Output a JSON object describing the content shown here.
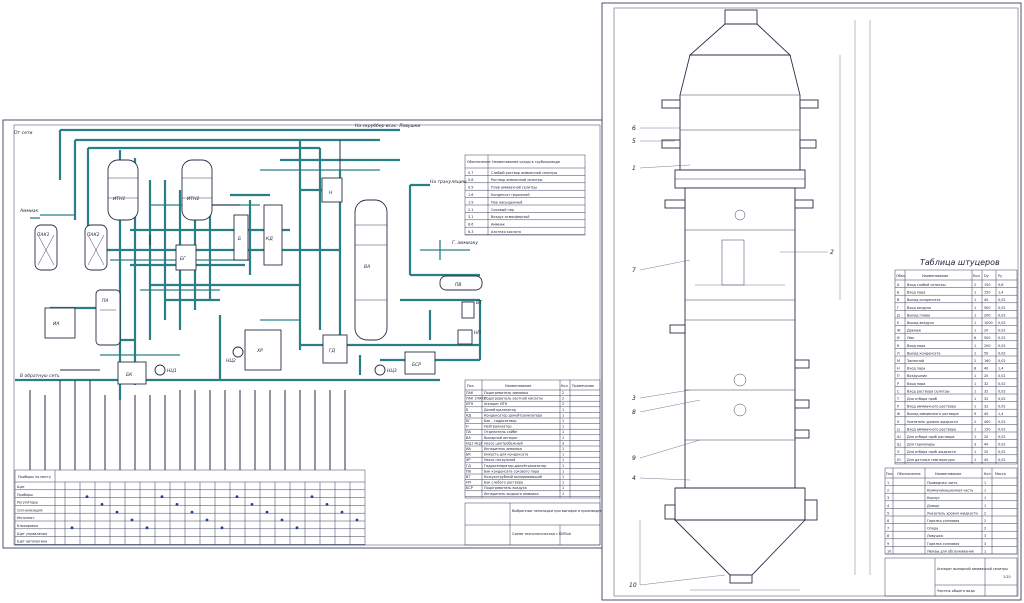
{
  "scheme": {
    "equipment": [
      "ПАК1",
      "ПАК2",
      "ИТН1",
      "ИТН2",
      "ПА",
      "ИА",
      "БК",
      "НЦ1",
      "НЦ2",
      "НЦ3",
      "БГ",
      "Б",
      "КД",
      "Н",
      "ВА",
      "ХР",
      "ГД",
      "ПВ",
      "ВТ",
      "НП",
      "БСР"
    ],
    "flow_labels": [
      "На скруббер всас. Ловушки",
      "На грануляцию",
      "Г. аммиаку",
      "Аммиак",
      "В обратную сеть",
      "От сети"
    ],
    "flows_table": {
      "header": [
        "Обозначение",
        "Наименование среды в трубопроводе"
      ],
      "rows": [
        [
          "0.7",
          "Слабый раствор аммиачной селитры"
        ],
        [
          "0.8",
          "Раствор аммиачной селитры"
        ],
        [
          "0.9",
          "Плав аммиачной селитры"
        ],
        [
          "1.6",
          "Конденсат парожний"
        ],
        [
          "1.9",
          "Пар насыщенный"
        ],
        [
          "2.1",
          "Соковый пар"
        ],
        [
          "3.1",
          "Воздух атмосферный"
        ],
        [
          "6.6",
          "Аммиак"
        ],
        [
          "6.3",
          "Азотная кислота"
        ]
      ]
    },
    "equipment_table": {
      "header": [
        "Поз.",
        "Наименование",
        "Кол",
        "Примечание"
      ],
      "rows": [
        [
          "ПАК",
          "Подогреватель аммиака",
          "2",
          ""
        ],
        [
          "ПАК 1ПАК2",
          "Подогреватель азотной кислоты",
          "2",
          ""
        ],
        [
          "ИТН",
          "Аппарат ИТН",
          "2",
          ""
        ],
        [
          "Б",
          "Донейтрализатор",
          "1",
          ""
        ],
        [
          "КД",
          "Конденсатор донейтрализатора",
          "1",
          ""
        ],
        [
          "БГ",
          "Бак - гидрозатвор",
          "1",
          ""
        ],
        [
          "Н",
          "Нейтрализатор",
          "1",
          ""
        ],
        [
          "ПА",
          "Отделитель сайбе",
          "1",
          ""
        ],
        [
          "ВА",
          "Выпарной аппарат",
          "1",
          ""
        ],
        [
          "НЦ1-НЦ3",
          "Насос центробежный",
          "3",
          ""
        ],
        [
          "ИА",
          "Испаритель аммиака",
          "1",
          ""
        ],
        [
          "БК",
          "Емкость для конденсата",
          "1",
          ""
        ],
        [
          "ХР",
          "Насос погружной",
          "1",
          ""
        ],
        [
          "ГД",
          "Гидросепаратор-донейтрализатор",
          "1",
          ""
        ],
        [
          "ПВ",
          "Бак конденсата сокового пара",
          "1",
          ""
        ],
        [
          "ВТ",
          "Кожухотрубный выпаривающий",
          "1",
          ""
        ],
        [
          "НП",
          "Бак слабого раствора",
          "1",
          ""
        ],
        [
          "БСР",
          "Подогреватель воздуха",
          "1",
          ""
        ],
        [
          "",
          "Испаритель жидкого аммиака",
          "1",
          ""
        ]
      ]
    },
    "instrument_panel_title": "Приборы по месту",
    "instrument_panel_rows": [
      "Щит",
      "Приборы",
      "Регуляторы",
      "Сигнализация",
      "Исполнит.",
      "Блокировка",
      "Щит управления",
      "Щит автоматики"
    ],
    "title_block": {
      "title": "Выбранные неполадки при выпарке в производстве аммиачной селитры",
      "subtitle": "Схема технологическая с КИПиА"
    }
  },
  "drawing": {
    "callouts": [
      "1",
      "2",
      "3",
      "4",
      "5",
      "6",
      "7",
      "8",
      "9",
      "10"
    ],
    "nozzle_table": {
      "title": "Таблица штуцеров",
      "header": [
        "Обоз.",
        "Наименование",
        "Кол",
        "Dy",
        "Py"
      ],
      "rows": [
        [
          "A",
          "Вход слабой селитры",
          "2",
          "150",
          "0,6"
        ],
        [
          "Б",
          "Вход пара",
          "1",
          "150",
          "1,4"
        ],
        [
          "В",
          "Выход конденсата",
          "1",
          "40",
          "0,02"
        ],
        [
          "Г",
          "Вход воздуха",
          "1",
          "500",
          "0,02"
        ],
        [
          "Д",
          "Выход плава",
          "1",
          "200",
          "0,02"
        ],
        [
          "Е",
          "Выход воздуха",
          "1",
          "1000",
          "0,02"
        ],
        [
          "Ж",
          "Дренаж",
          "1",
          "20",
          "0,02"
        ],
        [
          "И",
          "Люк",
          "6",
          "500",
          "0,02"
        ],
        [
          "К",
          "Вход пара",
          "1",
          "200",
          "0,02"
        ],
        [
          "Л",
          "Выход конденсата",
          "1",
          "50",
          "0,02"
        ],
        [
          "М",
          "Запасной",
          "2",
          "160",
          "0,02"
        ],
        [
          "Н",
          "Вход пара",
          "8",
          "40",
          "1,4"
        ],
        [
          "П",
          "Воздушник",
          "1",
          "20",
          "0,02"
        ],
        [
          "Р",
          "Вход пара",
          "1",
          "32",
          "0,02"
        ],
        [
          "С",
          "Вход раствора селитры",
          "1",
          "32",
          "0,02"
        ],
        [
          "Т",
          "Для отбора проб",
          "1",
          "32",
          "0,02"
        ],
        [
          "У",
          "Вход аммиачного раствора",
          "1",
          "32",
          "0,02"
        ],
        [
          "Ф",
          "Выход аммиачного раствора",
          "9",
          "40",
          "1,4"
        ],
        [
          "Х",
          "Указатель уровня жидкости",
          "2",
          "400",
          "0,02"
        ],
        [
          "Ц",
          "Вход аммиачного раствора",
          "1",
          "150",
          "0,02"
        ],
        [
          "Ш",
          "Для отбора проб раствора",
          "1",
          "20",
          "0,02"
        ],
        [
          "Щ",
          "Для термопары",
          "3",
          "40",
          "0,02"
        ],
        [
          "Э",
          "Для отбора проб жидкости",
          "1",
          "20",
          "0,02"
        ],
        [
          "Ю",
          "Для датчика температуры",
          "1",
          "40",
          "0,02"
        ]
      ]
    },
    "parts_table": {
      "header": [
        "Поз.",
        "Обозначение",
        "Наименование",
        "Кол",
        "Масса"
      ],
      "rows": [
        [
          "1",
          "",
          "Проводная часть",
          "1",
          ""
        ],
        [
          "2",
          "",
          "Коммуникационная часть",
          "1",
          ""
        ],
        [
          "3",
          "",
          "Корпус",
          "1",
          ""
        ],
        [
          "4",
          "",
          "Днище",
          "1",
          ""
        ],
        [
          "5",
          "",
          "Указатель уровня жидкости",
          "2",
          ""
        ],
        [
          "6",
          "",
          "Горелка сопловая",
          "2",
          ""
        ],
        [
          "7",
          "",
          "Опора",
          "2",
          ""
        ],
        [
          "8",
          "",
          "Ловушка",
          "3",
          ""
        ],
        [
          "9",
          "",
          "Горелка сопловая",
          "3",
          ""
        ],
        [
          "10",
          "",
          "Люквы для обслуживания",
          "1",
          ""
        ]
      ]
    },
    "title_block": {
      "title": "Аппарат выпарной аммиачной селитры",
      "subtitle": "Чертеж общего вида",
      "scale": "1:20"
    }
  }
}
